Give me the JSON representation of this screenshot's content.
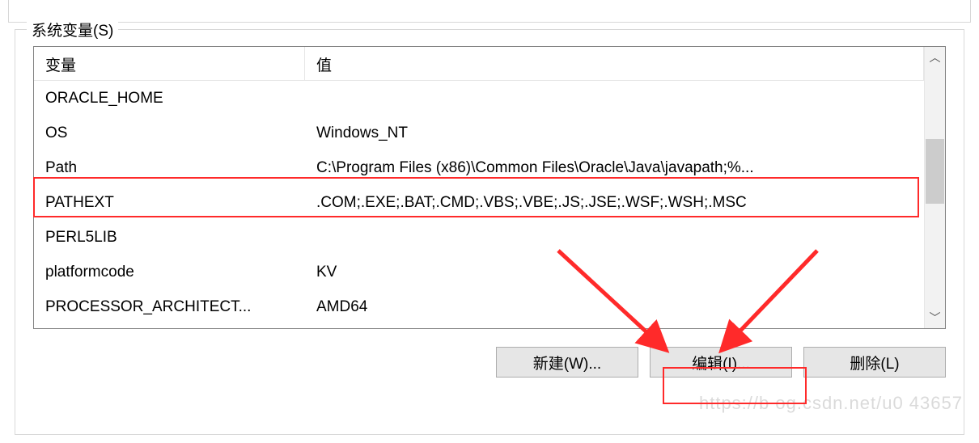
{
  "group": {
    "title": "系统变量(S)"
  },
  "columns": {
    "name": "变量",
    "value": "值"
  },
  "rows": [
    {
      "name": "ORACLE_HOME",
      "value": ""
    },
    {
      "name": "OS",
      "value": "Windows_NT"
    },
    {
      "name": "Path",
      "value": "C:\\Program Files (x86)\\Common Files\\Oracle\\Java\\javapath;%..."
    },
    {
      "name": "PATHEXT",
      "value": ".COM;.EXE;.BAT;.CMD;.VBS;.VBE;.JS;.JSE;.WSF;.WSH;.MSC"
    },
    {
      "name": "PERL5LIB",
      "value": ""
    },
    {
      "name": "platformcode",
      "value": "KV"
    },
    {
      "name": "PROCESSOR_ARCHITECT...",
      "value": "AMD64"
    }
  ],
  "buttons": {
    "new": "新建(W)...",
    "edit": "编辑(I)...",
    "delete": "删除(L)"
  },
  "icons": {
    "scroll_up": "︿",
    "scroll_down": "﹀"
  },
  "watermark": "https://b og.csdn.net/u0   43657",
  "annotations": {
    "highlight_color": "#ff2a2a",
    "highlighted_row": "Path",
    "highlighted_button": "edit"
  }
}
